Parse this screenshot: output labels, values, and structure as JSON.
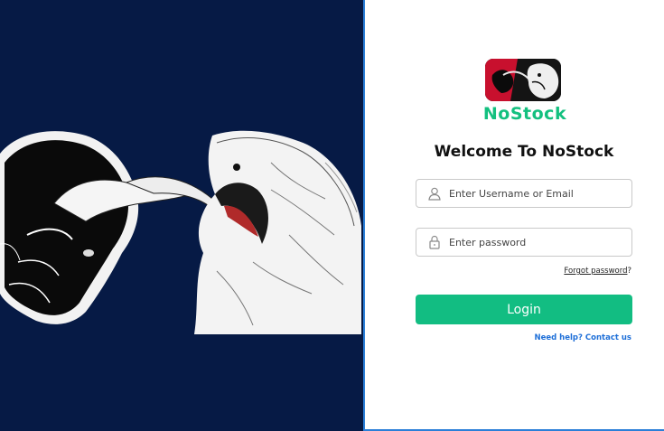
{
  "brand": {
    "name": "NoStock",
    "color": "#13c07f"
  },
  "hero": {
    "background": "#061a45",
    "image": "bull-vs-bear-illustration"
  },
  "form": {
    "title": "Welcome To NoStock",
    "username": {
      "placeholder": "Enter Username or Email",
      "value": "",
      "icon": "user-icon"
    },
    "password": {
      "placeholder": "Enter password",
      "value": "",
      "icon": "lock-icon"
    },
    "forgot": {
      "link": "Forgot password",
      "suffix": "?"
    },
    "login_label": "Login",
    "help": {
      "prefix": "Need help?",
      "link": "Contact us"
    }
  },
  "colors": {
    "accent": "#12bd82",
    "link": "#1e6fd8",
    "divider": "#2b7fd8"
  }
}
